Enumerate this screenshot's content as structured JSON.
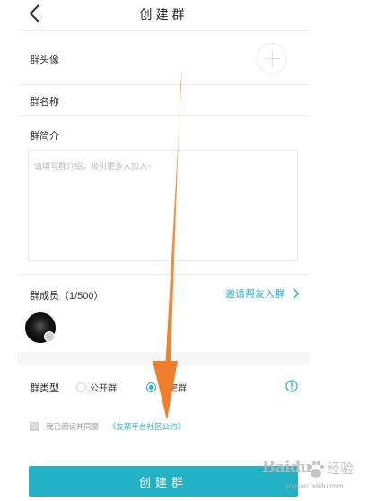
{
  "header": {
    "title": "创建群",
    "back_icon": "chevron-left-icon"
  },
  "form": {
    "avatar_label": "群头像",
    "avatar_add_icon": "plus-icon",
    "name_label": "群名称",
    "intro_label": "群简介",
    "intro_placeholder": "请填写群介绍，吸引更多人加入~",
    "intro_value": ""
  },
  "members": {
    "label": "群成员（1/500）",
    "invite_label": "邀请帮友入群",
    "invite_icon": "chevron-right-icon"
  },
  "group_type": {
    "label": "群类型",
    "options": [
      "公开群",
      "私密群"
    ],
    "selected": "私密群",
    "info_icon": "exclamation-circle-icon"
  },
  "agreement": {
    "checked": false,
    "prefix": "我已阅读并同意",
    "link": "《友帮平台社区公约》"
  },
  "submit": {
    "label": "创建群"
  },
  "watermark": {
    "brand": "Baidu",
    "suffix": "经验",
    "url": "jingyan.baidu.com"
  },
  "colors": {
    "accent": "#23b1c6",
    "link": "#26b0c9",
    "arrow": "#f08a3c",
    "divider": "#ececec",
    "placeholder": "#b8b8b8"
  }
}
